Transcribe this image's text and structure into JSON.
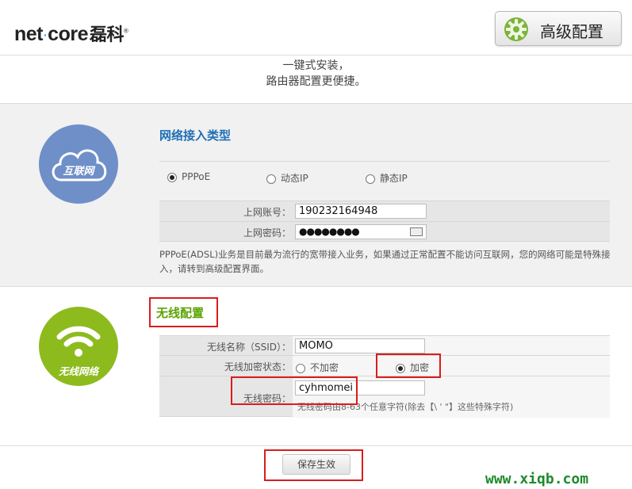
{
  "header": {
    "brand_en": "net",
    "brand_sep": "·",
    "brand_en2": "core",
    "brand_cn": "磊科",
    "brand_reg": "®",
    "advanced_button": "高级配置",
    "advanced_icon": "gear-icon"
  },
  "slogan": {
    "line1": "一键式安装，",
    "line2": "路由器配置更便捷。"
  },
  "internet": {
    "icon_label": "互联网",
    "icon": "cloud-icon",
    "title": "网络接入类型",
    "options": [
      "PPPoE",
      "动态IP",
      "静态IP"
    ],
    "selected": "PPPoE",
    "account_label": "上网账号：",
    "account_value": "190232164948",
    "password_label": "上网密码：",
    "password_value": "●●●●●●●●",
    "note": "PPPoE(ADSL)业务是目前最为流行的宽带接入业务，如果通过正常配置不能访问互联网，您的网络可能是特殊接入，请转到高级配置界面。"
  },
  "wireless": {
    "icon_label": "无线网络",
    "icon": "wifi-icon",
    "title": "无线配置",
    "ssid_label": "无线名称（SSID）：",
    "ssid_value": "MOMO",
    "security_label": "无线加密状态：",
    "security_options": [
      "不加密",
      "加密"
    ],
    "security_selected": "加密",
    "password_label": "无线密码：",
    "password_value": "cyhmomei",
    "password_hint": "无线密码由8-63个任意字符(除去【\\ ' \"】这些特殊字符)"
  },
  "footer": {
    "save_button": "保存生效",
    "watermark": "www.xiqb.com"
  },
  "colors": {
    "annotation_red": "#d91d1d",
    "title_blue": "#1f6fb5",
    "title_green": "#5aa300",
    "circle_blue": "#6f8fc8",
    "circle_green": "#8dbb1e",
    "watermark_green": "#1d8a2a"
  }
}
